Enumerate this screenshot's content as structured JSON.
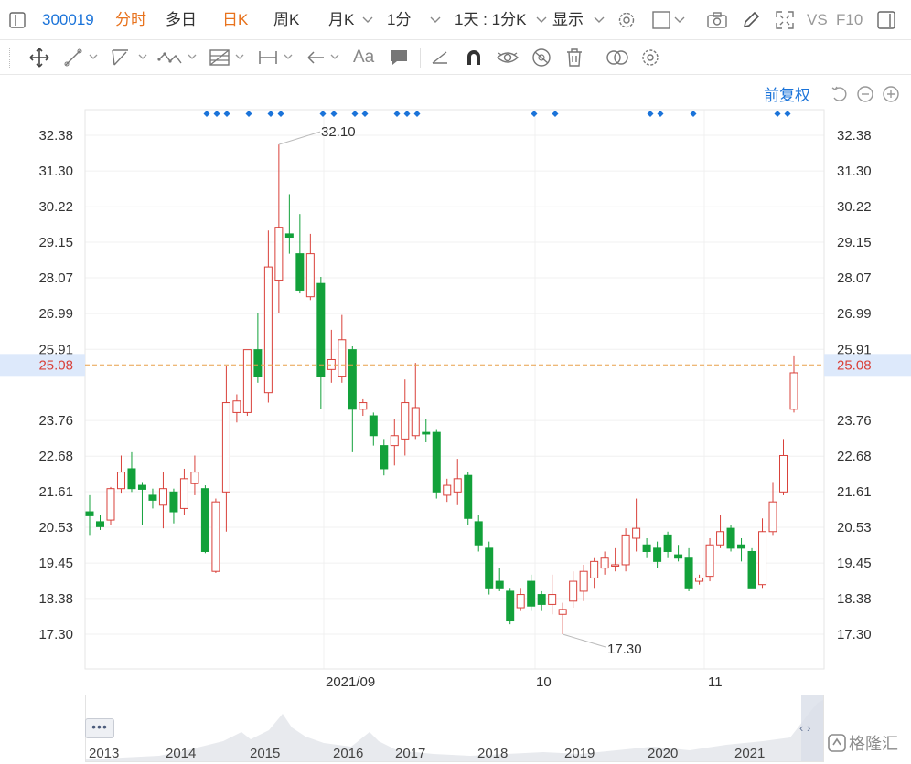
{
  "toolbar": {
    "stock_code": "300019",
    "period_fenshi": "分时",
    "period_duori": "多日",
    "period_rik": "日K",
    "period_zhouk": "周K",
    "period_yuek": "月K",
    "period_min": "1分",
    "day_min": "1天 : 1分K",
    "display": "显示",
    "vs": "VS",
    "f10": "F10",
    "colors": {
      "accent": "#1a73d9",
      "active": "#e8731e"
    }
  },
  "drawing_tools": [
    "move-icon",
    "line-icon",
    "channel-icon",
    "wave-icon",
    "fib-icon",
    "range-icon",
    "arrow-icon",
    "text-icon",
    "note-icon",
    "ruler-icon",
    "magnet-icon",
    "eye-icon",
    "hide-icon",
    "trash-icon",
    "compare-icon",
    "settings-icon"
  ],
  "text_tool_label": "Aa",
  "chart_controls": {
    "adjust_label": "前复权"
  },
  "price_axis": {
    "ticks": [
      "32.38",
      "31.30",
      "30.22",
      "29.15",
      "28.07",
      "26.99",
      "25.91",
      "23.76",
      "22.68",
      "21.61",
      "20.53",
      "19.45",
      "18.38",
      "17.30"
    ],
    "current_price": "25.08"
  },
  "annotations": {
    "high": "32.10",
    "low": "17.30"
  },
  "x_axis": [
    "2021/09",
    "10",
    "11"
  ],
  "navigator": {
    "years": [
      "2013",
      "2014",
      "2015",
      "2016",
      "2017",
      "2018",
      "2019",
      "2020",
      "2021"
    ],
    "more_label": "•••",
    "arrows": "‹ ›"
  },
  "logo_text": "格隆汇",
  "chart_data": {
    "type": "candlestick",
    "title": "",
    "ylim": [
      16.6,
      33.3
    ],
    "grid": true,
    "colors": {
      "up": "#d9413a",
      "down": "#12a13a"
    },
    "candles": [
      {
        "o": 21.0,
        "c": 20.88,
        "h": 21.5,
        "l": 20.3
      },
      {
        "o": 20.7,
        "c": 20.55,
        "h": 20.9,
        "l": 20.45
      },
      {
        "o": 20.75,
        "c": 21.7,
        "h": 21.75,
        "l": 20.6
      },
      {
        "o": 21.7,
        "c": 22.2,
        "h": 22.7,
        "l": 21.55
      },
      {
        "o": 22.3,
        "c": 21.7,
        "h": 22.8,
        "l": 21.6
      },
      {
        "o": 21.8,
        "c": 21.68,
        "h": 21.9,
        "l": 20.6
      },
      {
        "o": 21.5,
        "c": 21.35,
        "h": 21.7,
        "l": 21.1
      },
      {
        "o": 21.2,
        "c": 21.7,
        "h": 22.2,
        "l": 20.5
      },
      {
        "o": 21.6,
        "c": 21.0,
        "h": 21.7,
        "l": 20.65
      },
      {
        "o": 21.1,
        "c": 22.0,
        "h": 22.3,
        "l": 20.9
      },
      {
        "o": 21.85,
        "c": 22.2,
        "h": 22.7,
        "l": 21.5
      },
      {
        "o": 21.7,
        "c": 19.8,
        "h": 21.8,
        "l": 19.75
      },
      {
        "o": 19.2,
        "c": 21.3,
        "h": 21.4,
        "l": 19.15
      },
      {
        "o": 21.6,
        "c": 24.3,
        "h": 25.4,
        "l": 20.4
      },
      {
        "o": 24.0,
        "c": 24.35,
        "h": 24.55,
        "l": 23.7
      },
      {
        "o": 24.0,
        "c": 25.9,
        "h": 25.2,
        "l": 23.9
      },
      {
        "o": 25.9,
        "c": 25.1,
        "h": 27.0,
        "l": 24.9
      },
      {
        "o": 24.6,
        "c": 28.4,
        "h": 29.5,
        "l": 24.3
      },
      {
        "o": 28.0,
        "c": 29.6,
        "h": 32.1,
        "l": 27.0
      },
      {
        "o": 29.4,
        "c": 29.3,
        "h": 30.6,
        "l": 28.8
      },
      {
        "o": 28.8,
        "c": 27.7,
        "h": 30.0,
        "l": 27.6
      },
      {
        "o": 27.5,
        "c": 28.8,
        "h": 29.4,
        "l": 27.4
      },
      {
        "o": 27.9,
        "c": 25.1,
        "h": 28.1,
        "l": 24.1
      },
      {
        "o": 25.3,
        "c": 25.6,
        "h": 26.5,
        "l": 24.9
      },
      {
        "o": 25.1,
        "c": 26.2,
        "h": 26.95,
        "l": 24.9
      },
      {
        "o": 25.9,
        "c": 24.1,
        "h": 26.0,
        "l": 22.8
      },
      {
        "o": 24.1,
        "c": 24.3,
        "h": 24.4,
        "l": 23.9
      },
      {
        "o": 23.9,
        "c": 23.3,
        "h": 24.0,
        "l": 23.0
      },
      {
        "o": 23.0,
        "c": 22.3,
        "h": 23.2,
        "l": 22.1
      },
      {
        "o": 23.0,
        "c": 23.3,
        "h": 23.8,
        "l": 22.4
      },
      {
        "o": 23.2,
        "c": 24.3,
        "h": 25.0,
        "l": 22.7
      },
      {
        "o": 23.3,
        "c": 24.15,
        "h": 25.5,
        "l": 23.2
      },
      {
        "o": 23.4,
        "c": 23.35,
        "h": 23.8,
        "l": 23.1
      },
      {
        "o": 23.4,
        "c": 21.6,
        "h": 23.5,
        "l": 21.4
      },
      {
        "o": 21.5,
        "c": 21.8,
        "h": 22.0,
        "l": 21.3
      },
      {
        "o": 21.6,
        "c": 22.0,
        "h": 22.6,
        "l": 21.2
      },
      {
        "o": 22.1,
        "c": 20.8,
        "h": 22.2,
        "l": 20.6
      },
      {
        "o": 20.7,
        "c": 20.0,
        "h": 20.9,
        "l": 19.8
      },
      {
        "o": 19.9,
        "c": 18.7,
        "h": 20.1,
        "l": 18.5
      },
      {
        "o": 18.9,
        "c": 18.7,
        "h": 19.3,
        "l": 18.6
      },
      {
        "o": 18.6,
        "c": 17.7,
        "h": 18.7,
        "l": 17.6
      },
      {
        "o": 18.1,
        "c": 18.5,
        "h": 18.7,
        "l": 18.0
      },
      {
        "o": 18.9,
        "c": 18.15,
        "h": 19.1,
        "l": 18.0
      },
      {
        "o": 18.5,
        "c": 18.2,
        "h": 18.6,
        "l": 18.0
      },
      {
        "o": 18.2,
        "c": 18.5,
        "h": 19.1,
        "l": 17.9
      },
      {
        "o": 17.9,
        "c": 18.05,
        "h": 18.25,
        "l": 17.3
      },
      {
        "o": 18.3,
        "c": 18.9,
        "h": 19.2,
        "l": 18.1
      },
      {
        "o": 18.6,
        "c": 19.2,
        "h": 19.4,
        "l": 18.3
      },
      {
        "o": 19.0,
        "c": 19.5,
        "h": 19.6,
        "l": 18.7
      },
      {
        "o": 19.3,
        "c": 19.6,
        "h": 19.8,
        "l": 19.1
      },
      {
        "o": 19.4,
        "c": 19.4,
        "h": 19.9,
        "l": 19.2
      },
      {
        "o": 19.4,
        "c": 20.3,
        "h": 20.5,
        "l": 19.2
      },
      {
        "o": 20.2,
        "c": 20.5,
        "h": 21.4,
        "l": 19.8
      },
      {
        "o": 20.0,
        "c": 19.8,
        "h": 20.2,
        "l": 19.6
      },
      {
        "o": 19.9,
        "c": 19.5,
        "h": 20.1,
        "l": 19.3
      },
      {
        "o": 20.3,
        "c": 19.8,
        "h": 20.4,
        "l": 19.6
      },
      {
        "o": 19.7,
        "c": 19.6,
        "h": 20.0,
        "l": 19.5
      },
      {
        "o": 19.6,
        "c": 18.7,
        "h": 19.9,
        "l": 18.6
      },
      {
        "o": 18.9,
        "c": 19.0,
        "h": 19.1,
        "l": 18.8
      },
      {
        "o": 19.05,
        "c": 20.0,
        "h": 20.2,
        "l": 18.9
      },
      {
        "o": 20.0,
        "c": 20.4,
        "h": 20.9,
        "l": 19.9
      },
      {
        "o": 20.5,
        "c": 19.9,
        "h": 20.6,
        "l": 19.8
      },
      {
        "o": 20.0,
        "c": 19.9,
        "h": 20.2,
        "l": 19.5
      },
      {
        "o": 19.8,
        "c": 18.7,
        "h": 19.9,
        "l": 18.7
      },
      {
        "o": 18.8,
        "c": 20.4,
        "h": 20.8,
        "l": 18.7
      },
      {
        "o": 20.4,
        "c": 21.3,
        "h": 21.9,
        "l": 20.3
      },
      {
        "o": 21.6,
        "c": 22.7,
        "h": 23.2,
        "l": 21.5
      },
      {
        "o": 24.1,
        "c": 25.2,
        "h": 25.7,
        "l": 24.0
      }
    ],
    "event_marker_groups": 9
  }
}
